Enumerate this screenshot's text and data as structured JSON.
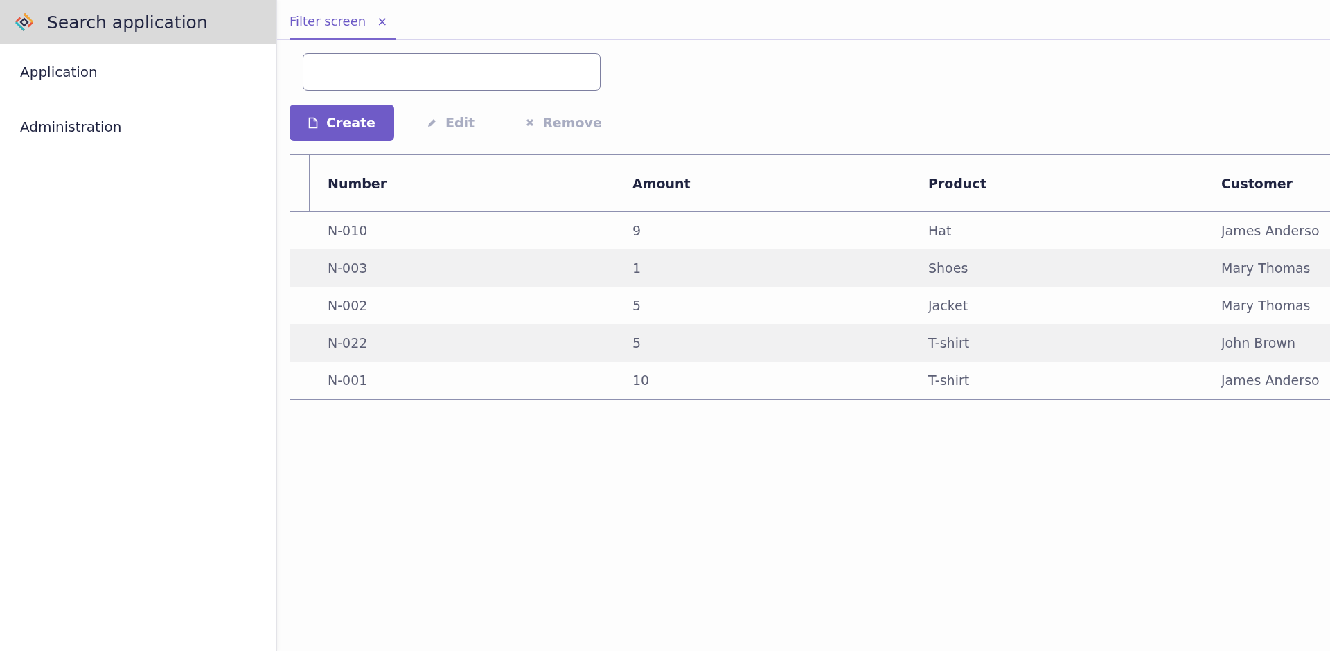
{
  "app": {
    "title": "Search application"
  },
  "sidebar": {
    "items": [
      {
        "label": "Application"
      },
      {
        "label": "Administration"
      }
    ]
  },
  "tabs": [
    {
      "label": "Filter screen",
      "close": "×",
      "selected": true
    }
  ],
  "buttons": [
    {
      "label": "Create",
      "kind": "create",
      "primary": true,
      "disabled": false
    },
    {
      "label": "Edit",
      "kind": "edit",
      "primary": false,
      "disabled": true
    },
    {
      "label": "Remove",
      "kind": "remove",
      "primary": false,
      "disabled": true
    }
  ],
  "table": {
    "columns": [
      "Number",
      "Amount",
      "Product",
      "Customer"
    ],
    "rows": [
      [
        "N-010",
        "9",
        "Hat",
        "James Anderso"
      ],
      [
        "N-003",
        "1",
        "Shoes",
        "Mary Thomas"
      ],
      [
        "N-002",
        "5",
        "Jacket",
        "Mary Thomas"
      ],
      [
        "N-022",
        "5",
        "T-shirt",
        "John Brown"
      ],
      [
        "N-001",
        "10",
        "T-shirt",
        "James Anderso"
      ]
    ]
  }
}
